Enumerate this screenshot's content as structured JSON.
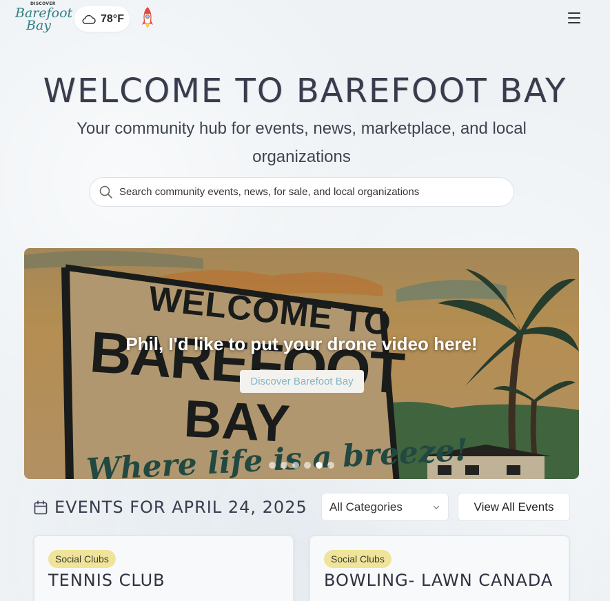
{
  "header": {
    "logo_small": "DISCOVER",
    "logo_line1": "Barefoot",
    "logo_line2": "Bay",
    "weather_temp": "78°F",
    "weather_icon": "cloud-icon",
    "rocket_icon": "rocket-icon",
    "menu_icon": "hamburger-menu-icon"
  },
  "hero": {
    "title": "WELCOME TO BAREFOOT BAY",
    "subtitle": "Your community hub for events, news, marketplace, and local organizations",
    "search_placeholder": "Search community events, news, for sale, and local organizations"
  },
  "banner": {
    "headline": "Phil, I'd like to put your drone video here!",
    "button_label": "Discover Barefoot Bay",
    "slide_count": 6,
    "active_slide": 5,
    "image_sign_line1": "WELCOME TO",
    "image_sign_line2": "BAREFOOT",
    "image_sign_line3": "BAY",
    "image_script": "Where life is a breeze!"
  },
  "events": {
    "heading": "EVENTS FOR APRIL 24, 2025",
    "category_select": "All Categories",
    "view_all_label": "View All Events",
    "cards": [
      {
        "badge": "Social Clubs",
        "title": "TENNIS CLUB"
      },
      {
        "badge": "Social Clubs",
        "title": "BOWLING- LAWN CANADA"
      }
    ]
  },
  "colors": {
    "accent_teal": "#2f7f82",
    "badge_yellow": "#efe49a",
    "button_text_blue": "#7fb7c8"
  }
}
